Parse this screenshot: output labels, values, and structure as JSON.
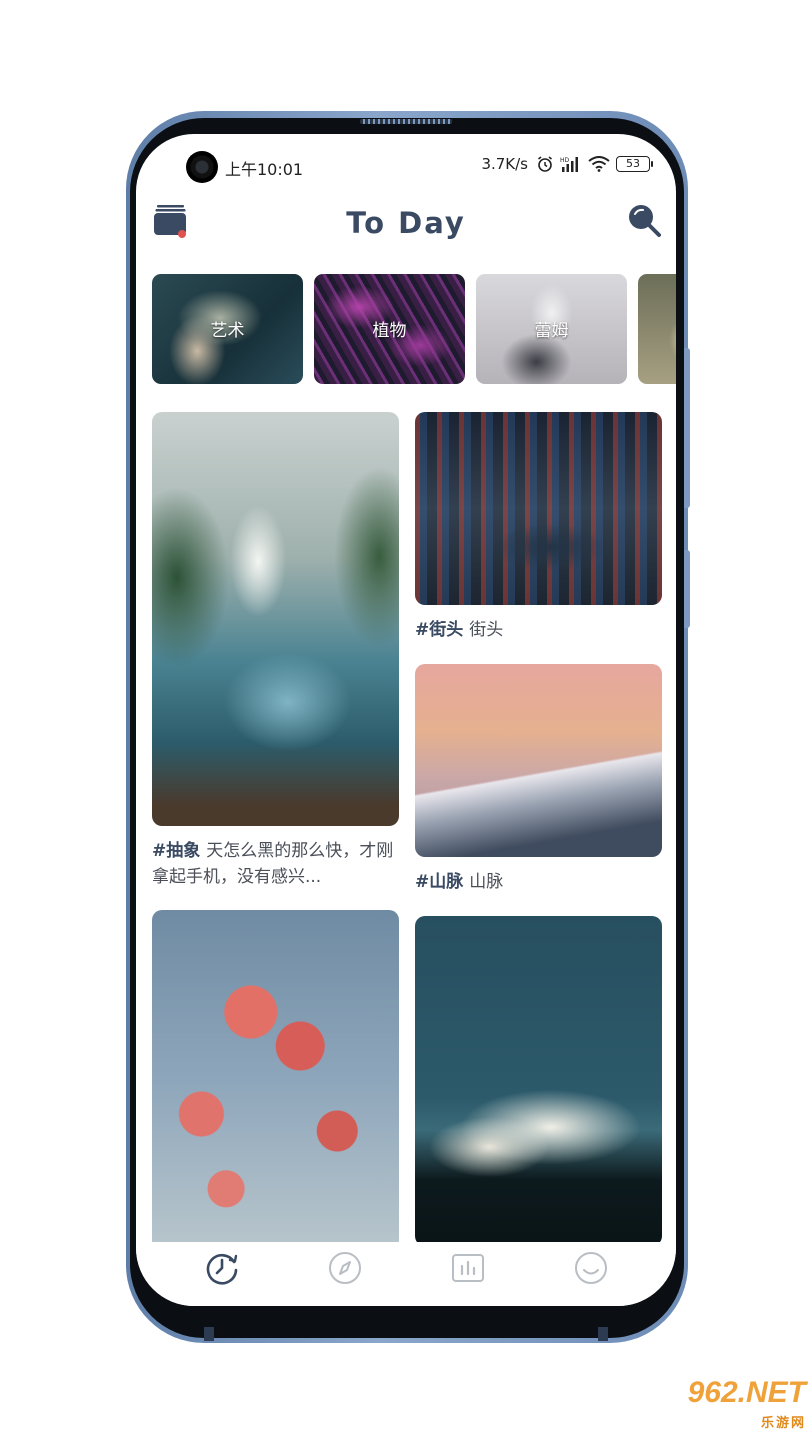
{
  "status_bar": {
    "time": "上午10:01",
    "net_speed": "3.7K/s",
    "battery": "53",
    "icons": [
      "alarm-icon",
      "hd-signal-icon",
      "wifi-icon",
      "battery-icon"
    ]
  },
  "header": {
    "title": "To Day",
    "left_icon": "wallet-icon",
    "right_icon": "search-icon",
    "accent_dot_color": "#e0524f"
  },
  "categories": [
    {
      "label": "艺术"
    },
    {
      "label": "植物"
    },
    {
      "label": "蕾姆"
    },
    {
      "label": ""
    }
  ],
  "feed": {
    "left": [
      {
        "tag": "#抽象",
        "text": "天怎么黑的那么快，才刚拿起手机，没有感兴..."
      },
      {
        "tag": "",
        "text": ""
      }
    ],
    "right": [
      {
        "tag": "#街头",
        "text": "街头"
      },
      {
        "tag": "#山脉",
        "text": "山脉"
      },
      {
        "tag": "",
        "text": ""
      }
    ]
  },
  "bottom_nav": [
    {
      "icon": "today-clock-icon",
      "active": true
    },
    {
      "icon": "compass-icon",
      "active": false
    },
    {
      "icon": "chart-icon",
      "active": false
    },
    {
      "icon": "smiley-profile-icon",
      "active": false
    }
  ],
  "colors": {
    "primary_text": "#3a4a63",
    "inactive_icon": "#b9bdc4",
    "frame": "#7f9ac0"
  },
  "watermark": {
    "main": "962.NET",
    "sub": "乐游网"
  }
}
